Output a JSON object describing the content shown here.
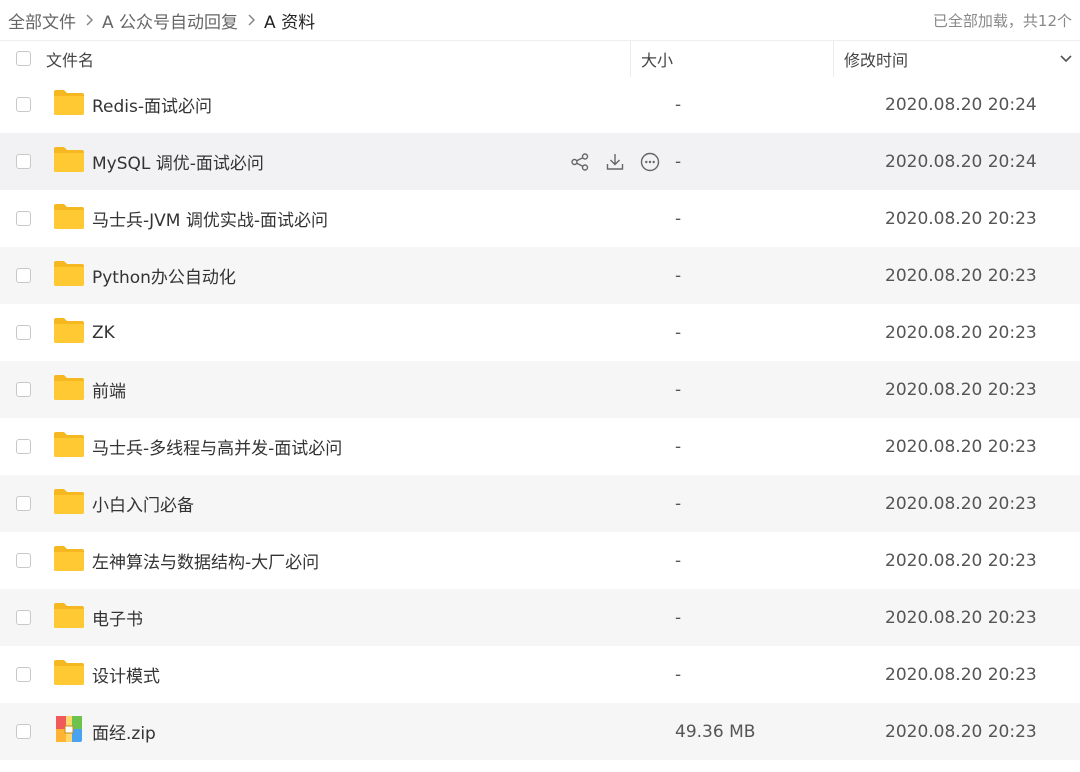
{
  "breadcrumb": {
    "items": [
      "全部文件",
      "A 公众号自动回复",
      "A 资料"
    ],
    "loaded_info": "已全部加载，共12个"
  },
  "columns": {
    "name": "文件名",
    "size": "大小",
    "modified": "修改时间"
  },
  "colors": {
    "folder": "#ffc933",
    "accent_text": "#333333"
  },
  "files": [
    {
      "name": "Redis-面试必问",
      "size": "-",
      "modified": "2020.08.20 20:24",
      "icon": "folder-icon"
    },
    {
      "name": "MySQL 调优-面试必问",
      "size": "-",
      "modified": "2020.08.20 20:24",
      "icon": "folder-icon"
    },
    {
      "name": "马士兵-JVM 调优实战-面试必问",
      "size": "-",
      "modified": "2020.08.20 20:23",
      "icon": "folder-icon"
    },
    {
      "name": "Python办公自动化",
      "size": "-",
      "modified": "2020.08.20 20:23",
      "icon": "folder-icon"
    },
    {
      "name": "ZK",
      "size": "-",
      "modified": "2020.08.20 20:23",
      "icon": "folder-icon"
    },
    {
      "name": "前端",
      "size": "-",
      "modified": "2020.08.20 20:23",
      "icon": "folder-icon"
    },
    {
      "name": "马士兵-多线程与高并发-面试必问",
      "size": "-",
      "modified": "2020.08.20 20:23",
      "icon": "folder-icon"
    },
    {
      "name": "小白入门必备",
      "size": "-",
      "modified": "2020.08.20 20:23",
      "icon": "folder-icon"
    },
    {
      "name": "左神算法与数据结构-大厂必问",
      "size": "-",
      "modified": "2020.08.20 20:23",
      "icon": "folder-icon"
    },
    {
      "name": "电子书",
      "size": "-",
      "modified": "2020.08.20 20:23",
      "icon": "folder-icon"
    },
    {
      "name": "设计模式",
      "size": "-",
      "modified": "2020.08.20 20:23",
      "icon": "folder-icon"
    },
    {
      "name": "面经.zip",
      "size": "49.36 MB",
      "modified": "2020.08.20 20:23",
      "icon": "zip-archive-icon"
    }
  ],
  "hover_row": 1,
  "row_action_icons": [
    "share-icon",
    "download-icon",
    "more-icon"
  ]
}
